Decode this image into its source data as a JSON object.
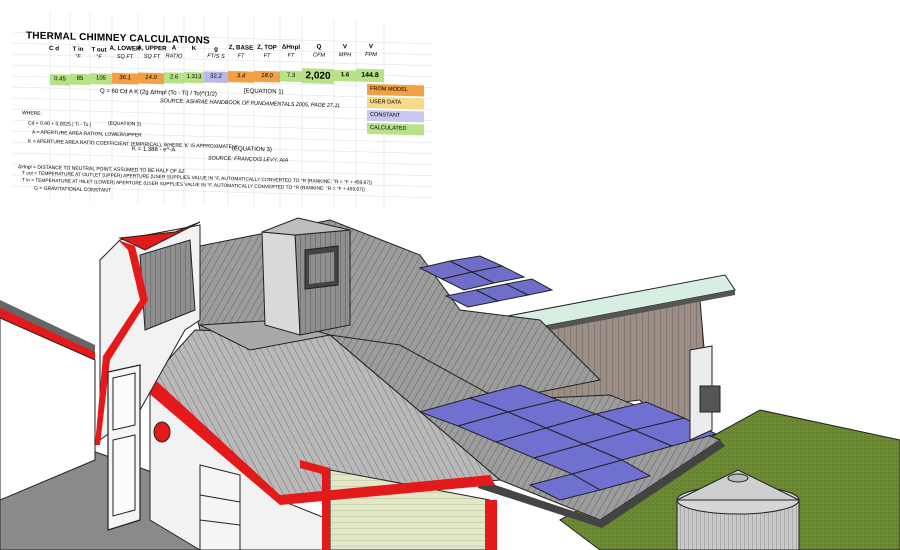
{
  "sheet": {
    "title": "THERMAL CHIMNEY CALCULATIONS",
    "headers": [
      {
        "name": "C d",
        "unit": ""
      },
      {
        "name": "T in",
        "unit": "°F"
      },
      {
        "name": "T out",
        "unit": "°F"
      },
      {
        "name": "A, LOWER",
        "unit": "SQ FT"
      },
      {
        "name": "A, UPPER",
        "unit": "SQ FT"
      },
      {
        "name": "A",
        "unit": "RATIO"
      },
      {
        "name": "K",
        "unit": ""
      },
      {
        "name": "g",
        "unit": "FT/S S"
      },
      {
        "name": "Z, BASE",
        "unit": "FT"
      },
      {
        "name": "Z, TOP",
        "unit": "FT"
      },
      {
        "name": "ΔHnpl",
        "unit": "FT"
      },
      {
        "name": "Q",
        "unit": "CFM"
      },
      {
        "name": "V",
        "unit": "MPH"
      },
      {
        "name": "V",
        "unit": "FPM"
      }
    ],
    "values": [
      {
        "v": "0.45",
        "color": "#b7e28a"
      },
      {
        "v": "85",
        "color": "#b7e28a"
      },
      {
        "v": "105",
        "color": "#b7e28a"
      },
      {
        "v": "36.1",
        "color": "#f2a043"
      },
      {
        "v": "14.0",
        "color": "#f2a043"
      },
      {
        "v": "2.6",
        "color": "#b7e28a"
      },
      {
        "v": "1.313",
        "color": "#b7e28a"
      },
      {
        "v": "32.2",
        "color": "#b8b7e8"
      },
      {
        "v": "3.4",
        "color": "#f2a043"
      },
      {
        "v": "18.0",
        "color": "#f2a043"
      },
      {
        "v": "7.3",
        "color": "#b7e28a"
      },
      {
        "v": "2,020",
        "color": "#b7e28a"
      },
      {
        "v": "1.6",
        "color": "#b7e28a"
      },
      {
        "v": "144.8",
        "color": "#b7e28a"
      }
    ],
    "equation1": "Q = 60 Cd A K (2g ΔHnpl (To - Ti) / To)^(1/2)",
    "equation1_label": "[EQUATION 1)",
    "source1": "SOURCE: ASHRAE HANDBOOK OF FUNDAMENTALS 2005, PAGE 27.11",
    "where": "WHERE:",
    "cd_eq": "Cd = 0.40 + 0.0025 | Ti - To |",
    "eq2_label": "(EQUATION 2)",
    "a_def": "A = APERTURE AREA RATION, LOWER/UPPER",
    "k_def": "K = APERTURE AREA RATIO COEFFICIENT (EMPIRICAL), WHERE 'K' IS APPROXIMATELY:",
    "k_eq": "K = 1.388 - e^-A",
    "eq3_label": "(EQUATION 3)",
    "source2": "SOURCE: FRANÇOIS LEVY, AIA",
    "defs": [
      "ΔHnpl = DISTANCE TO NEUTRAL POINT, ASSUMED TO BE HALF OF ΔZ",
      "T out = TEMPERATURE AT OUTLET (UPPER) APERTURE (USER SUPPLIES VALUE IN °F, AUTOMATICALLY CONVERTED TO °R (RANKINE:  °R = °F + 459.67))",
      "T in = TEMPERATURE AT INLET (LOWER) APERTURE (USER SUPPLIES VALUE IN °F, AUTOMATICALLY CONVERTED TO °R (RANKINE:  °R = °F + 459.67))",
      "G = GRAVITATIONAL CONSTANT"
    ],
    "legend": [
      {
        "label": "FROM MODEL",
        "color": "#f2a043"
      },
      {
        "label": "USER DATA",
        "color": "#f7d98a"
      },
      {
        "label": "CONSTANT",
        "color": "#c9c8ee"
      },
      {
        "label": "CALCULATED",
        "color": "#b7e28a"
      }
    ]
  }
}
